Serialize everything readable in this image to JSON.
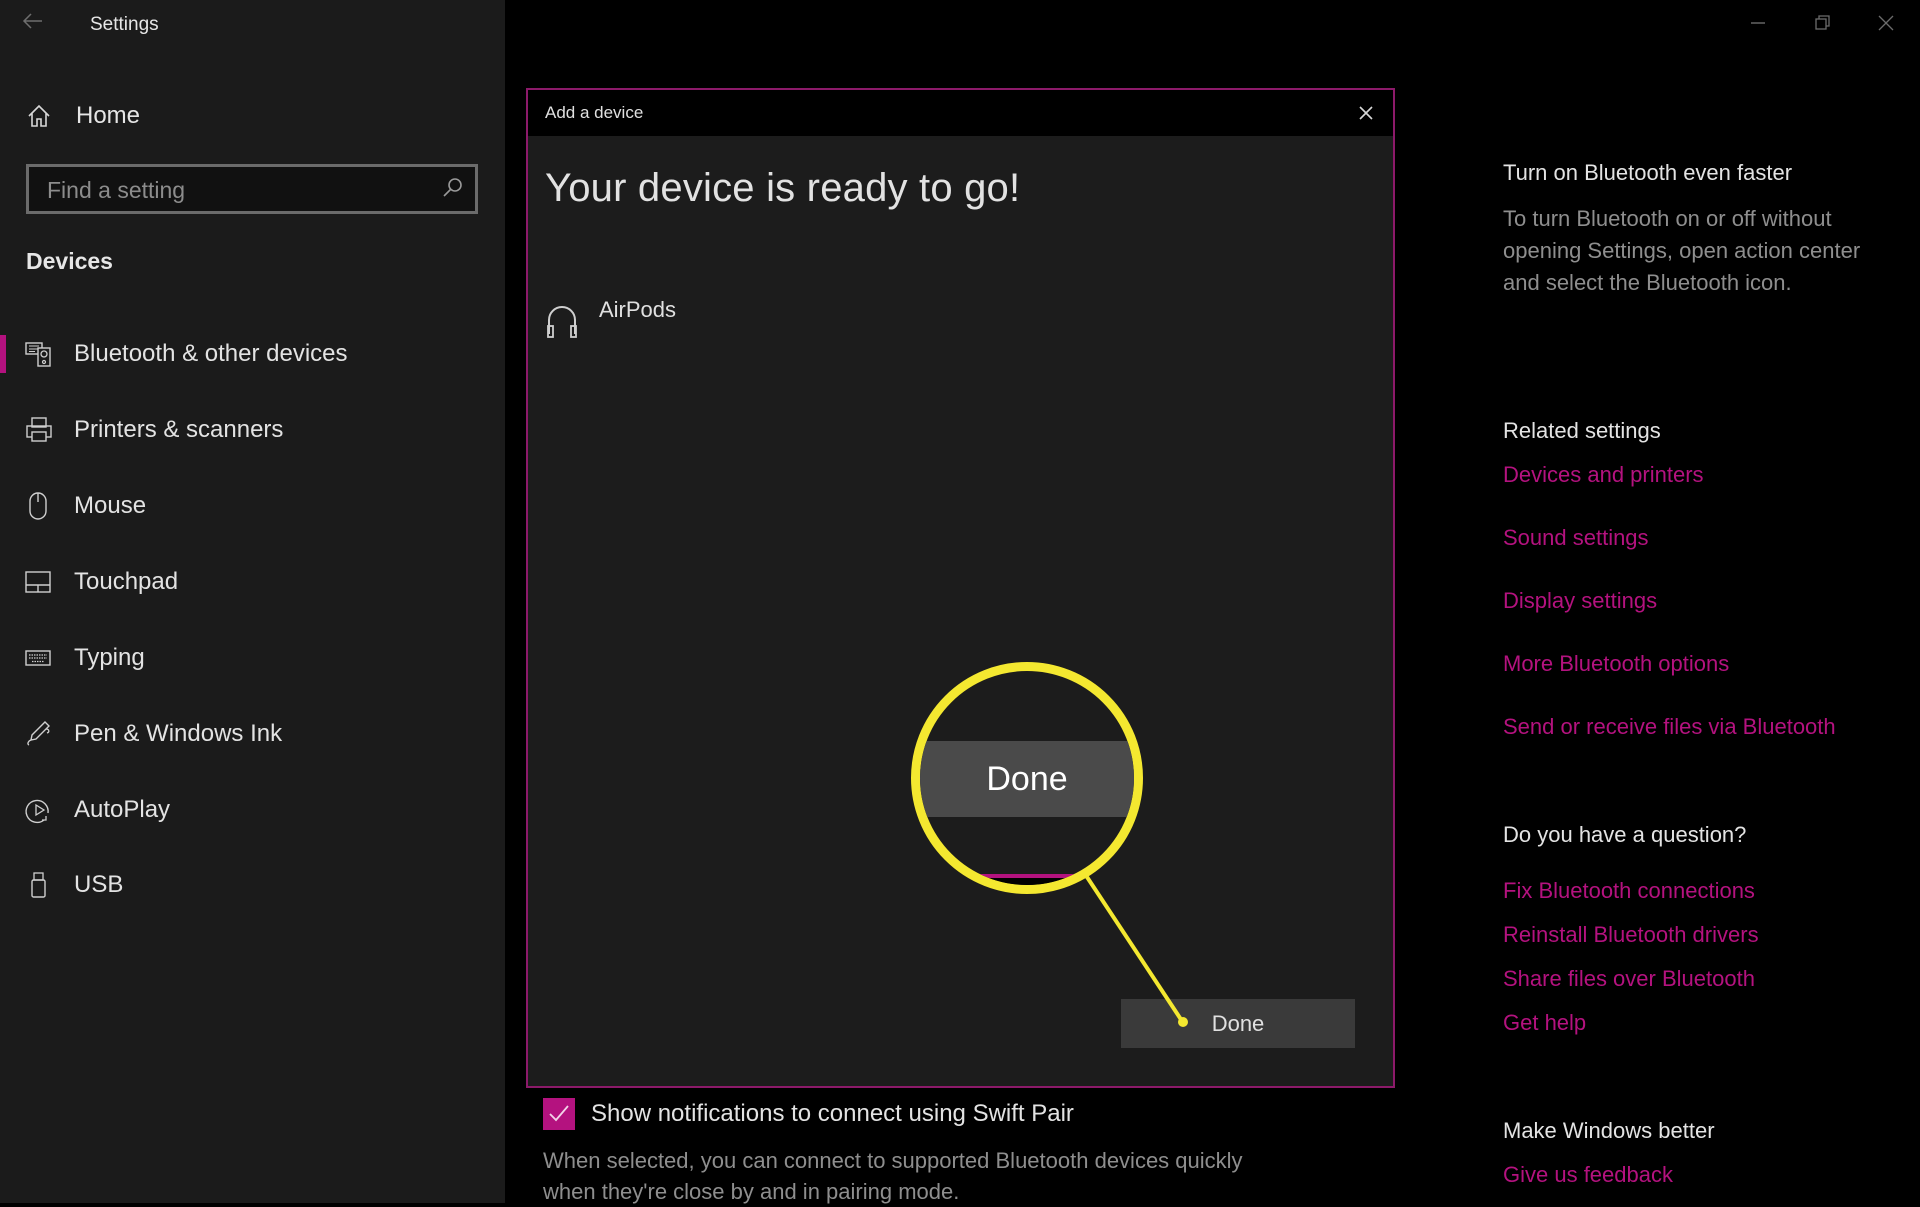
{
  "window": {
    "title": "Settings",
    "back_icon": "back-arrow-icon",
    "controls": [
      "minimize",
      "restore",
      "close"
    ]
  },
  "sidebar": {
    "home_label": "Home",
    "search_placeholder": "Find a setting",
    "section_label": "Devices",
    "items": [
      {
        "label": "Bluetooth & other devices",
        "icon": "bluetooth-devices-icon",
        "selected": true
      },
      {
        "label": "Printers & scanners",
        "icon": "printer-icon",
        "selected": false
      },
      {
        "label": "Mouse",
        "icon": "mouse-icon",
        "selected": false
      },
      {
        "label": "Touchpad",
        "icon": "touchpad-icon",
        "selected": false
      },
      {
        "label": "Typing",
        "icon": "keyboard-icon",
        "selected": false
      },
      {
        "label": "Pen & Windows Ink",
        "icon": "pen-icon",
        "selected": false
      },
      {
        "label": "AutoPlay",
        "icon": "autoplay-icon",
        "selected": false
      },
      {
        "label": "USB",
        "icon": "usb-icon",
        "selected": false
      }
    ]
  },
  "dialog": {
    "title": "Add a device",
    "heading": "Your device is ready to go!",
    "device_name": "AirPods",
    "device_icon": "headphones-icon",
    "done_label": "Done",
    "callout_label": "Done"
  },
  "main": {
    "swift_pair_label": "Show notifications to connect using Swift Pair",
    "swift_pair_checked": true,
    "swift_pair_description": "When selected, you can connect to supported Bluetooth devices quickly when they're close by and in pairing mode."
  },
  "right_panel": {
    "tip_heading": "Turn on Bluetooth even faster",
    "tip_text": "To turn Bluetooth on or off without opening Settings, open action center and select the Bluetooth icon.",
    "related_heading": "Related settings",
    "related_links": [
      "Devices and printers",
      "Sound settings",
      "Display settings",
      "More Bluetooth options",
      "Send or receive files via Bluetooth"
    ],
    "question_heading": "Do you have a question?",
    "question_links": [
      "Fix Bluetooth connections",
      "Reinstall Bluetooth drivers",
      "Share files over Bluetooth",
      "Get help"
    ],
    "feedback_heading": "Make Windows better",
    "feedback_link": "Give us feedback"
  },
  "colors": {
    "accent": "#b4127f",
    "highlight": "#f4e830",
    "sidebar_bg": "#1b1b1b",
    "dialog_bg": "#1c1c1c"
  }
}
